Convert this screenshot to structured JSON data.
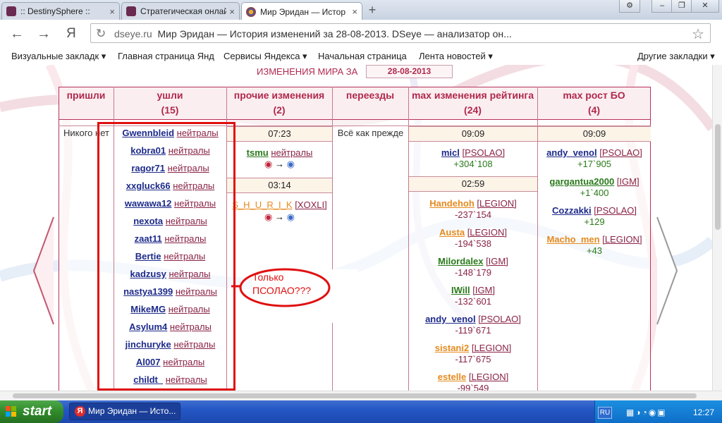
{
  "tabs": [
    {
      "title": ":: DestinySphere ::",
      "close": "×"
    },
    {
      "title": "Стратегическая онлай",
      "close": "×"
    },
    {
      "title": "Мир Эридан — Истор",
      "close": "×"
    }
  ],
  "new_tab": "+",
  "toolbar": {
    "back": "←",
    "forward": "→",
    "yandex": "Я",
    "reload": "↻",
    "url_domain": "dseye.ru",
    "url_title": "Мир Эридан — История изменений за 28-08-2013. DSeye — анализатор он...",
    "star": "☆"
  },
  "bookmarks": [
    "Визуальные закладк ▾",
    "Главная страница Янд",
    "Сервисы Яндекса ▾",
    "Начальная страница",
    "Лента новостей ▾",
    "Другие закладки ▾"
  ],
  "page": {
    "changes_label": "ИЗМЕНЕНИЯ МИРА ЗА",
    "date": "28-08-2013",
    "headers": [
      {
        "title": "пришли",
        "count": ""
      },
      {
        "title": "ушли",
        "count": "(15)"
      },
      {
        "title": "прочие изменения",
        "count": "(2)"
      },
      {
        "title": "переезды",
        "count": ""
      },
      {
        "title": "max изменения рейтинга",
        "count": "(24)"
      },
      {
        "title": "max рост БО",
        "count": "(4)"
      }
    ],
    "arrived_text": "Никого нет",
    "moves_text": "Всё как прежде",
    "left_players": [
      {
        "nick": "Gwennbleid",
        "side": "нейтралы"
      },
      {
        "nick": "kobra01",
        "side": "нейтралы"
      },
      {
        "nick": "ragor71",
        "side": "нейтралы"
      },
      {
        "nick": "xxgluck66",
        "side": "нейтралы"
      },
      {
        "nick": "wawawa12",
        "side": "нейтралы"
      },
      {
        "nick": "nexota",
        "side": "нейтралы"
      },
      {
        "nick": "zaat11",
        "side": "нейтралы"
      },
      {
        "nick": "Bertie",
        "side": "нейтралы"
      },
      {
        "nick": "kadzusy",
        "side": "нейтралы"
      },
      {
        "nick": "nastya1399",
        "side": "нейтралы"
      },
      {
        "nick": "MikeMG",
        "side": "нейтралы"
      },
      {
        "nick": "Asylum4",
        "side": "нейтралы"
      },
      {
        "nick": "jinchuryke",
        "side": "нейтралы"
      },
      {
        "nick": "Al007",
        "side": "нейтралы"
      },
      {
        "nick": "childt_",
        "side": "нейтралы"
      }
    ],
    "other_changes": [
      {
        "time": "07:23",
        "nick": "tsmu",
        "clan": "нейтралы",
        "arrow": "→"
      },
      {
        "time": "03:14",
        "nick": "S_H_U_R_I_K",
        "clan": "[XOXLI]",
        "arrow": "→"
      }
    ],
    "rating": {
      "groups": [
        {
          "time": "09:09",
          "entries": [
            {
              "nick": "micl",
              "clan": "[PSOLAO]",
              "delta": "+304`108",
              "color": "blue"
            }
          ]
        },
        {
          "time": "02:59",
          "entries": [
            {
              "nick": "Handehoh",
              "clan": "[LEGION]",
              "delta": "-237`154",
              "color": "orange"
            },
            {
              "nick": "Austa",
              "clan": "[LEGION]",
              "delta": "-194`538",
              "color": "orange"
            },
            {
              "nick": "Milordalex",
              "clan": "[IGM]",
              "delta": "-148`179",
              "color": "green"
            },
            {
              "nick": "IWill",
              "clan": "[IGM]",
              "delta": "-132`601",
              "color": "green"
            },
            {
              "nick": "andy_venol",
              "clan": "[PSOLAO]",
              "delta": "-119`671",
              "color": "blue"
            },
            {
              "nick": "sistani2",
              "clan": "[LEGION]",
              "delta": "-117`675",
              "color": "orange"
            },
            {
              "nick": "estelle",
              "clan": "[LEGION]",
              "delta": "-99`549",
              "color": "orange"
            }
          ]
        }
      ]
    },
    "bo": {
      "time": "09:09",
      "entries": [
        {
          "nick": "andy_venol",
          "clan": "[PSOLAO]",
          "delta": "+17`905",
          "color": "blue"
        },
        {
          "nick": "gargantua2000",
          "clan": "[IGM]",
          "delta": "+1`400",
          "color": "green"
        },
        {
          "nick": "Cozzakki",
          "clan": "[PSOLAO]",
          "delta": "+129",
          "color": "blue"
        },
        {
          "nick": "Macho_men",
          "clan": "[LEGION]",
          "delta": "+43",
          "color": "orange"
        }
      ]
    },
    "annotation_line1": "Только",
    "annotation_line2": "ПСОЛАО???"
  },
  "taskbar": {
    "start": "start",
    "item": "Мир Эридан — Исто...",
    "lang": "RU",
    "clock": "12:27"
  },
  "colors": {
    "accent": "#b0294c",
    "annotation_red": "#e01010",
    "nick_blue": "#1d2a8a",
    "nick_green": "#2a7a1a",
    "nick_orange": "#e68a1e"
  }
}
